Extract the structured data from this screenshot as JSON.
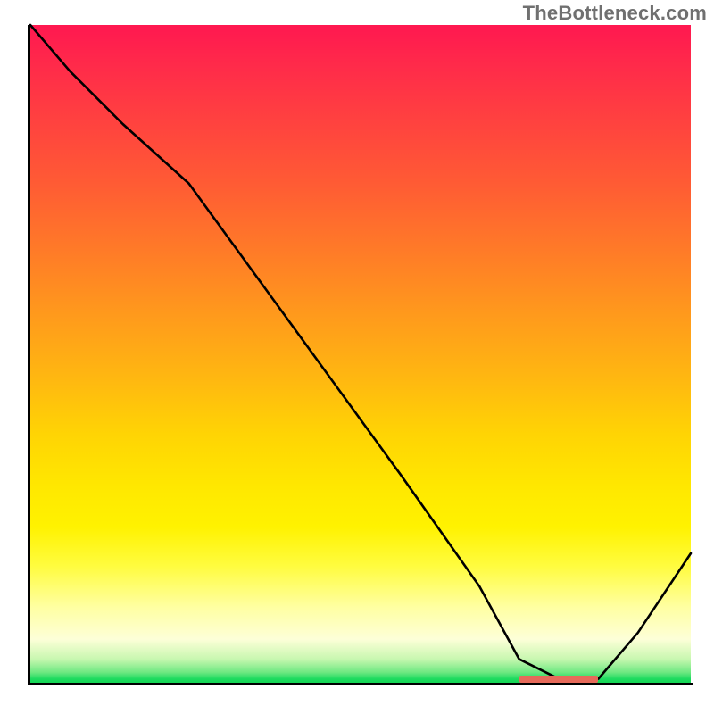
{
  "watermark": {
    "text": "TheBottleneck.com"
  },
  "axes": {
    "x_range": [
      0,
      100
    ],
    "y_range": [
      0,
      100
    ]
  },
  "marker": {
    "x_start_pct": 74.0,
    "x_end_pct": 86.0,
    "y_pct": 99.0,
    "color": "#e66a5a"
  },
  "chart_data": {
    "type": "line",
    "title": "",
    "xlabel": "",
    "ylabel": "",
    "xlim": [
      0,
      100
    ],
    "ylim": [
      0,
      100
    ],
    "x": [
      0,
      6,
      14,
      24,
      40,
      56,
      68,
      74,
      80,
      86,
      92,
      100
    ],
    "y": [
      100,
      93,
      85,
      76,
      54,
      32,
      15,
      4,
      1,
      1,
      8,
      20
    ],
    "annotations": [],
    "legend": null,
    "grid": false,
    "background_gradient": "red-to-green-vertical"
  }
}
